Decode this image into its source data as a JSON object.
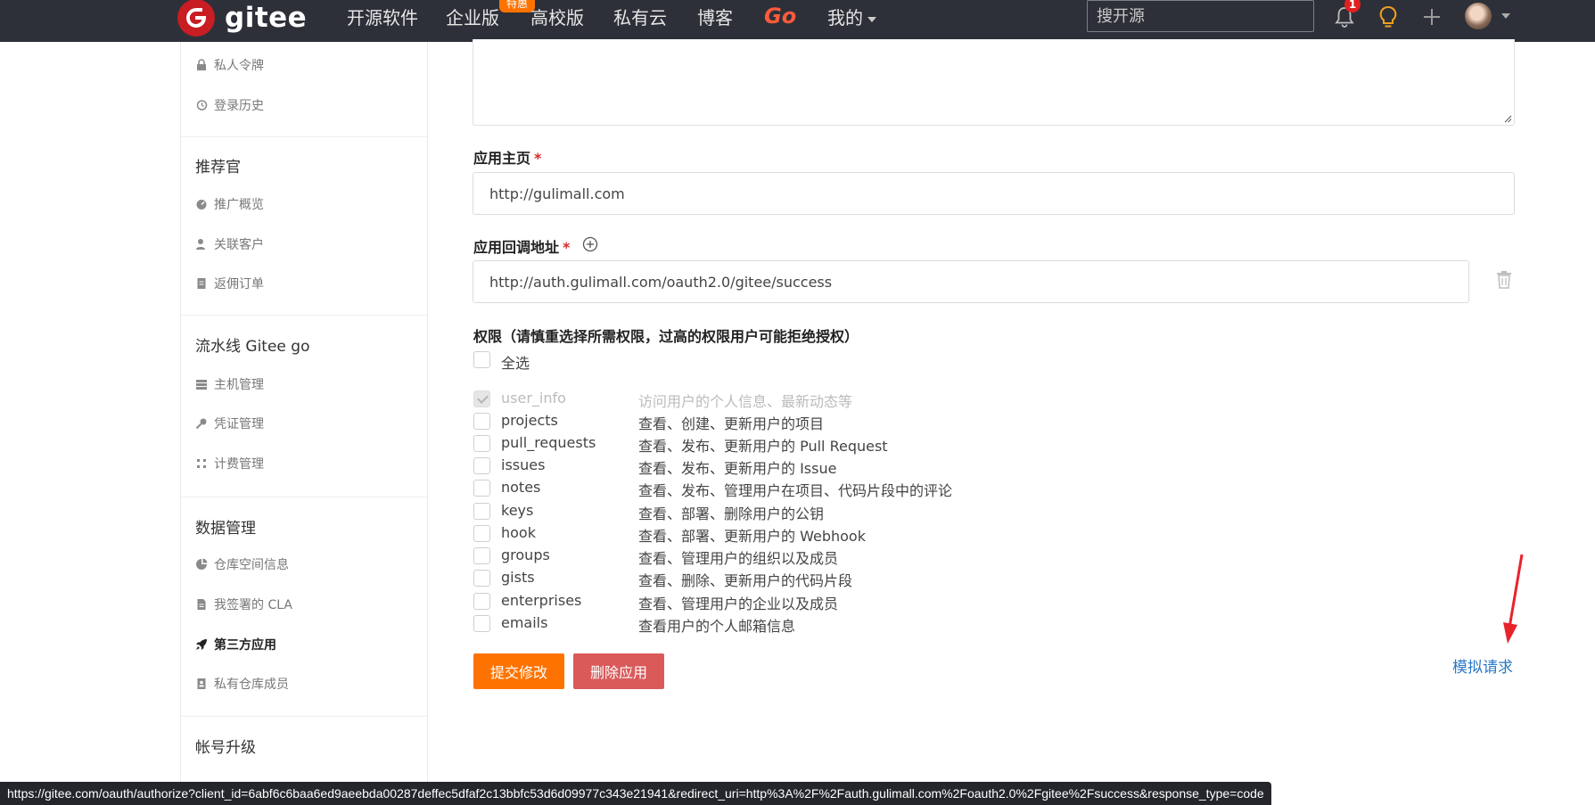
{
  "navbar": {
    "logo_text": "gitee",
    "items": [
      "开源软件",
      "企业版",
      "高校版",
      "私有云",
      "博客"
    ],
    "go_label": "Go",
    "my_label": "我的",
    "promo_badge": "特惠",
    "search_placeholder": "搜开源",
    "notification_count": "1"
  },
  "sidebar": {
    "top_items": [
      "私人令牌",
      "登录历史"
    ],
    "sections": [
      {
        "heading": "推荐官",
        "items": [
          "推广概览",
          "关联客户",
          "返佣订单"
        ]
      },
      {
        "heading": "流水线 Gitee go",
        "items": [
          "主机管理",
          "凭证管理",
          "计费管理"
        ]
      },
      {
        "heading": "数据管理",
        "items": [
          "仓库空间信息",
          "我签署的 CLA",
          "第三方应用",
          "私有仓库成员"
        ]
      },
      {
        "heading": "帐号升级",
        "items": []
      }
    ],
    "active_item": "第三方应用"
  },
  "form": {
    "homepage_label": "应用主页",
    "homepage_value": "http://gulimall.com",
    "callback_label": "应用回调地址",
    "callback_value": "http://auth.gulimall.com/oauth2.0/gitee/success",
    "required_mark": "*",
    "permissions_title": "权限（请慎重选择所需权限，过高的权限用户可能拒绝授权）",
    "select_all_label": "全选",
    "scopes": [
      {
        "name": "user_info",
        "desc": "访问用户的个人信息、最新动态等",
        "checked": true,
        "disabled": true
      },
      {
        "name": "projects",
        "desc": "查看、创建、更新用户的项目",
        "checked": false,
        "disabled": false
      },
      {
        "name": "pull_requests",
        "desc": "查看、发布、更新用户的 Pull Request",
        "checked": false,
        "disabled": false
      },
      {
        "name": "issues",
        "desc": "查看、发布、更新用户的 Issue",
        "checked": false,
        "disabled": false
      },
      {
        "name": "notes",
        "desc": "查看、发布、管理用户在项目、代码片段中的评论",
        "checked": false,
        "disabled": false
      },
      {
        "name": "keys",
        "desc": "查看、部署、删除用户的公钥",
        "checked": false,
        "disabled": false
      },
      {
        "name": "hook",
        "desc": "查看、部署、更新用户的 Webhook",
        "checked": false,
        "disabled": false
      },
      {
        "name": "groups",
        "desc": "查看、管理用户的组织以及成员",
        "checked": false,
        "disabled": false
      },
      {
        "name": "gists",
        "desc": "查看、删除、更新用户的代码片段",
        "checked": false,
        "disabled": false
      },
      {
        "name": "enterprises",
        "desc": "查看、管理用户的企业以及成员",
        "checked": false,
        "disabled": false
      },
      {
        "name": "emails",
        "desc": "查看用户的个人邮箱信息",
        "checked": false,
        "disabled": false
      }
    ],
    "submit_label": "提交修改",
    "delete_label": "删除应用",
    "simulate_label": "模拟请求"
  },
  "status_bar": {
    "url": "https://gitee.com/oauth/authorize?client_id=6abf6c6baa6ed9aeebda00287deffec5dfaf2c13bbfc53d6d09977c343e21941&redirect_uri=http%3A%2F%2Fauth.gulimall.com%2Foauth2.0%2Fgitee%2Fsuccess&response_type=code"
  },
  "colors": {
    "navbar_bg": "#2d3038",
    "brand_red": "#c71d23",
    "submit_orange": "#fe7300",
    "delete_red": "#da5a5a",
    "link_blue": "#2a78c5"
  }
}
